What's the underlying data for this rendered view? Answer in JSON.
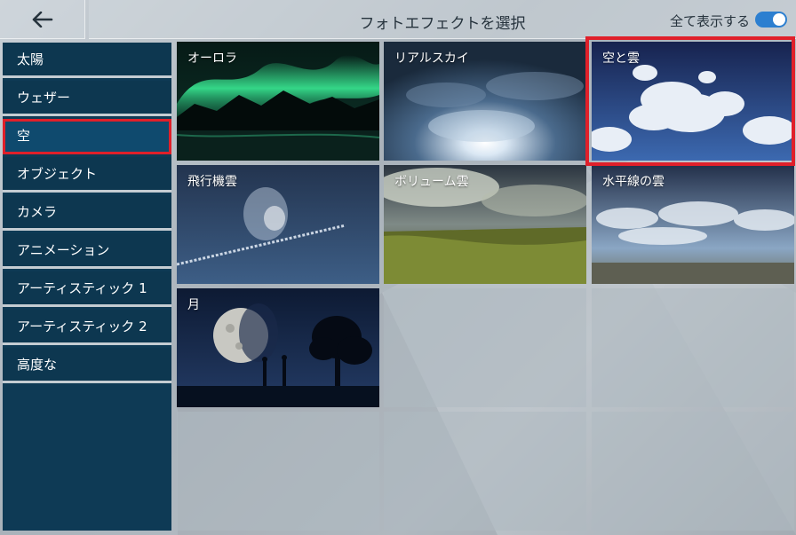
{
  "header": {
    "back_icon": "arrow-left-icon",
    "title": "フォトエフェクトを選択",
    "show_all_label": "全て表示する",
    "show_all_enabled": true
  },
  "sidebar": {
    "items": [
      {
        "label": "太陽",
        "selected": false
      },
      {
        "label": "ウェザー",
        "selected": false
      },
      {
        "label": "空",
        "selected": true
      },
      {
        "label": "オブジェクト",
        "selected": false
      },
      {
        "label": "カメラ",
        "selected": false
      },
      {
        "label": "アニメーション",
        "selected": false
      },
      {
        "label": "アーティスティック 1",
        "selected": false
      },
      {
        "label": "アーティスティック 2",
        "selected": false
      },
      {
        "label": "高度な",
        "selected": false
      }
    ]
  },
  "effects": [
    {
      "label": "オーロラ",
      "selected": false
    },
    {
      "label": "リアルスカイ",
      "selected": false
    },
    {
      "label": "空と雲",
      "selected": true
    },
    {
      "label": "飛行機雲",
      "selected": false
    },
    {
      "label": "ボリューム雲",
      "selected": false
    },
    {
      "label": "水平線の雲",
      "selected": false
    },
    {
      "label": "月",
      "selected": false
    }
  ],
  "colors": {
    "highlight": "#e0202a",
    "sidebar_bg": "#0d3750",
    "toggle_on": "#2c7fd0"
  }
}
